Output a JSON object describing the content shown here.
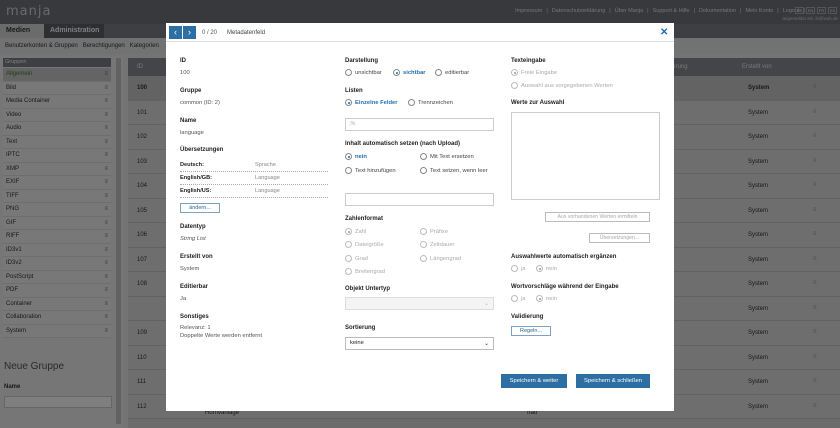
{
  "app": {
    "logo": "manja"
  },
  "toplinks": [
    "Impressum",
    "|",
    "Datenschutzerklärung",
    "|",
    "Über Manja",
    "|",
    "Support & Hilfe",
    "|",
    "Dokumentation",
    "|",
    "Mein Konto",
    "|",
    "Logout",
    "|"
  ],
  "user_line": "angemeldet als: ib@web.de",
  "langs": [
    "DE",
    "EN",
    "FR",
    "ES"
  ],
  "tabs": {
    "media": "Medien",
    "admin": "Administration"
  },
  "subnav": [
    "Benutzerkonten & Gruppen",
    "Berechtigungen",
    "Kategorien"
  ],
  "sidebar": {
    "header": "Gruppen",
    "items": [
      "Allgemein",
      "Bild",
      "Media Container",
      "Video",
      "Audio",
      "Text",
      "IPTC",
      "XMP",
      "EXIF",
      "TIFF",
      "PNG",
      "GIF",
      "RIFF",
      "ID3v1",
      "ID3v2",
      "PostScript",
      "PDF",
      "Container",
      "Collaboration",
      "System"
    ],
    "selected": "Allgemein",
    "new_group_title": "Neue Gruppe",
    "name_label": "Name"
  },
  "table": {
    "headers": {
      "id": "ID",
      "created_by": "Erstellt von",
      "group": "Gruppe",
      "extra": "Validierung"
    },
    "rows": [
      {
        "id": "100",
        "created_by": "System"
      },
      {
        "id": "101",
        "created_by": "System"
      },
      {
        "id": "102",
        "created_by": "System"
      },
      {
        "id": "103",
        "created_by": "System"
      },
      {
        "id": "104",
        "created_by": "System"
      },
      {
        "id": "105",
        "created_by": "System"
      },
      {
        "id": "106",
        "created_by": "System"
      },
      {
        "id": "107",
        "created_by": "System"
      },
      {
        "id": "108",
        "created_by": "System"
      },
      {
        "id": "",
        "created_by": "System"
      },
      {
        "id": "109",
        "created_by": "System"
      },
      {
        "id": "110",
        "created_by": "System"
      },
      {
        "id": "111",
        "created_by": "System"
      },
      {
        "id": "112",
        "created_by": "System"
      }
    ],
    "last_row_text": "Hornvanlage",
    "last_row_mid": "frau"
  },
  "modal": {
    "counter": "0 / 20",
    "title": "Metadatenfeld",
    "col1": {
      "id_label": "ID",
      "id_value": "100",
      "group_label": "Gruppe",
      "group_value": "common (ID: 2)",
      "name_label": "Name",
      "name_value": "language",
      "translations_label": "Übersetzungen",
      "translations": [
        {
          "lang": "Deutsch:",
          "value": "Sprache"
        },
        {
          "lang": "English/GB:",
          "value": "Language"
        },
        {
          "lang": "English/US:",
          "value": "Language"
        }
      ],
      "change_button": "ändern...",
      "datatype_label": "Datentyp",
      "datatype_value": "String List",
      "created_label": "Erstellt von",
      "created_value": "System",
      "editable_label": "Editierbar",
      "editable_value": "Ja",
      "misc_label": "Sonstiges",
      "misc_line1": "Relevanz: 1",
      "misc_line2": "Doppelte Werte werden entfernt"
    },
    "col2": {
      "display_label": "Darstellung",
      "display_options": [
        "unsichtbar",
        "sichtbar",
        "editierbar"
      ],
      "display_selected": "sichtbar",
      "lists_label": "Listen",
      "lists_options": [
        "Einzelne Felder",
        "Trennzeichen"
      ],
      "lists_selected": "Einzelne Felder",
      "separator_placeholder": ",%",
      "auto_label": "Inhalt automatisch setzen (nach Upload)",
      "auto_options": [
        "nein",
        "Mit Text ersetzen",
        "Text hinzufügen",
        "Text setzen, wenn leer"
      ],
      "auto_selected": "nein",
      "number_label": "Zahlenformat",
      "number_options": [
        "Zahl",
        "Präfixe",
        "Dateigröße",
        "Zeitdauer",
        "Grad",
        "Längengrad",
        "Breitengrad"
      ],
      "number_selected": "Zahl",
      "subtype_label": "Objekt Untertyp",
      "sort_label": "Sortierung",
      "sort_value": "keine"
    },
    "col3": {
      "input_label": "Texteingabe",
      "input_options": [
        "Freie Eingabe",
        "Auswahl aus vorgegebenen Werten"
      ],
      "input_selected": "Freie Eingabe",
      "values_label": "Werte zur Auswahl",
      "fill_button": "Aus vorhandenen Werten ermitteln",
      "translations_button": "Übersetzungen...",
      "autocomplete_label": "Auswahlwerte automatisch ergänzen",
      "autocomplete_options": [
        "ja",
        "nein"
      ],
      "autocomplete_selected": "nein",
      "suggest_label": "Wortvorschläge während der Eingabe",
      "suggest_options": [
        "ja",
        "nein"
      ],
      "suggest_selected": "nein",
      "validation_label": "Validierung",
      "rules_button": "Regeln..."
    },
    "save_continue": "Speichern & weiter",
    "save_close": "Speichern & schließen"
  }
}
